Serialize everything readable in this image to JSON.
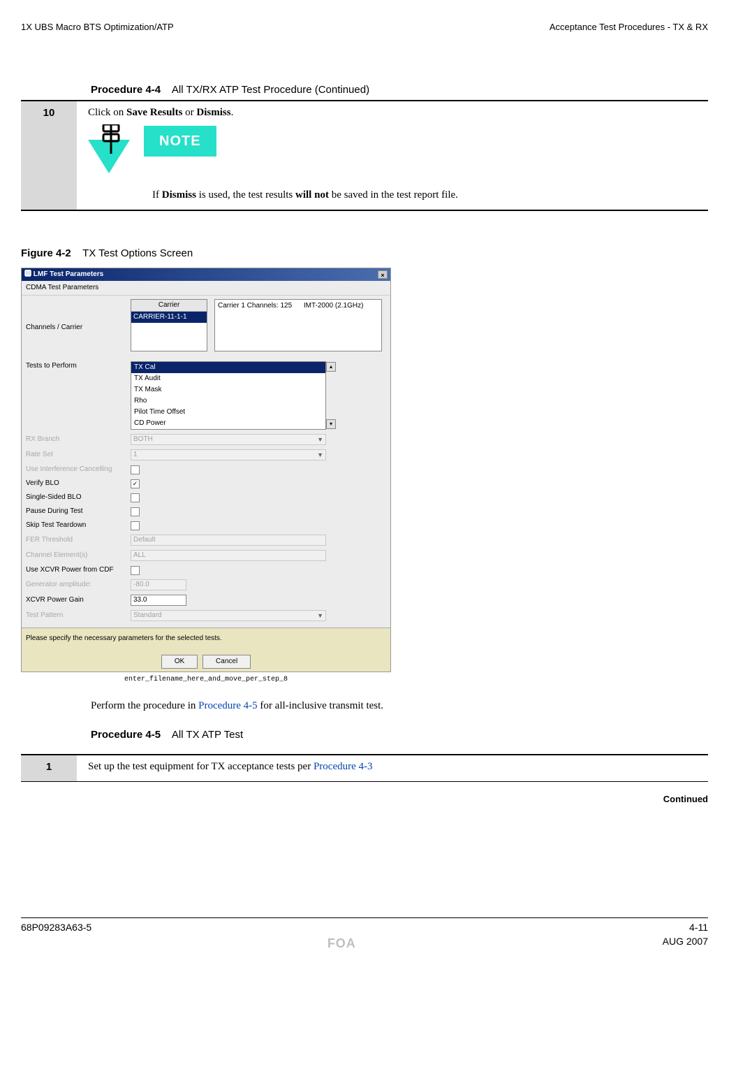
{
  "header": {
    "left": "1X UBS Macro BTS Optimization/ATP",
    "right": "Acceptance Test Procedures - TX & RX"
  },
  "procedure_4_4": {
    "label_bold": "Procedure 4-4",
    "label_rest": "All TX/RX ATP Test Procedure (Continued)",
    "step_num": "10",
    "step_text_pre": "Click on ",
    "step_text_b1": "Save Results",
    "step_text_mid": " or ",
    "step_text_b2": "Dismiss",
    "step_text_post": ".",
    "note_label": "NOTE",
    "note_pre": "If ",
    "note_b1": "Dismiss",
    "note_mid": " is used, the test results ",
    "note_b2": "will not",
    "note_post": " be saved in the test report file."
  },
  "figure_4_2": {
    "label_bold": "Figure 4-2",
    "label_rest": "TX Test Options Screen"
  },
  "screenshot": {
    "title": "LMF Test Parameters",
    "section1": "CDMA Test Parameters",
    "row_channels": "Channels / Carrier",
    "carrier_label": "Carrier",
    "carrier_selected": "CARRIER-11-1-1",
    "carrier_channels_label": "Carrier 1 Channels:",
    "carrier_channels_val": "125",
    "band": "IMT-2000 (2.1GHz)",
    "row_tests": "Tests to Perform",
    "tests": [
      "TX Cal",
      "TX Audit",
      "TX Mask",
      "Rho",
      "Pilot Time Offset",
      "CD Power"
    ],
    "rows": {
      "rx_branch": {
        "label": "RX Branch",
        "value": "BOTH",
        "disabled": true
      },
      "rate_set": {
        "label": "Rate Set",
        "value": "1",
        "disabled": true
      },
      "use_intf": {
        "label": "Use Interference Cancelling",
        "checked": false,
        "disabled": true
      },
      "verify_blo": {
        "label": "Verify BLO",
        "checked": true,
        "disabled": false
      },
      "single_blo": {
        "label": "Single-Sided BLO",
        "checked": false,
        "disabled": false
      },
      "pause_test": {
        "label": "Pause During Test",
        "checked": false,
        "disabled": false
      },
      "skip_td": {
        "label": "Skip Test Teardown",
        "checked": false,
        "disabled": false
      },
      "fer_thr": {
        "label": "FER Threshold",
        "value": "Default",
        "disabled": true
      },
      "chan_elem": {
        "label": "Channel Element(s)",
        "value": "ALL",
        "disabled": true
      },
      "use_xcvr_cdf": {
        "label": "Use XCVR Power from CDF",
        "checked": false,
        "disabled": false
      },
      "gen_amp": {
        "label": "Generator amplitude:",
        "value": "-80.0",
        "disabled": true
      },
      "xcvr_gain": {
        "label": "XCVR Power Gain",
        "value": "33.0",
        "disabled": false
      },
      "test_pattern": {
        "label": "Test Pattern",
        "value": "Standard",
        "disabled": true
      }
    },
    "hint": "Please specify the necessary parameters for the selected tests.",
    "ok": "OK",
    "cancel": "Cancel",
    "caption": "enter_filename_here_and_move_per_step_8"
  },
  "body_para": {
    "pre": "Perform the procedure in ",
    "link": "Procedure 4-5",
    "post": " for all-inclusive transmit test."
  },
  "procedure_4_5": {
    "label_bold": "Procedure 4-5",
    "label_rest": "All TX ATP Test",
    "step_num": "1",
    "step_text_pre": "Set up the test equipment for TX acceptance tests per ",
    "step_link": "Procedure 4-3"
  },
  "continued": "Continued",
  "footer": {
    "doc_num": "68P09283A63-5",
    "page": "4-11",
    "foa": "FOA",
    "date": "AUG 2007"
  }
}
